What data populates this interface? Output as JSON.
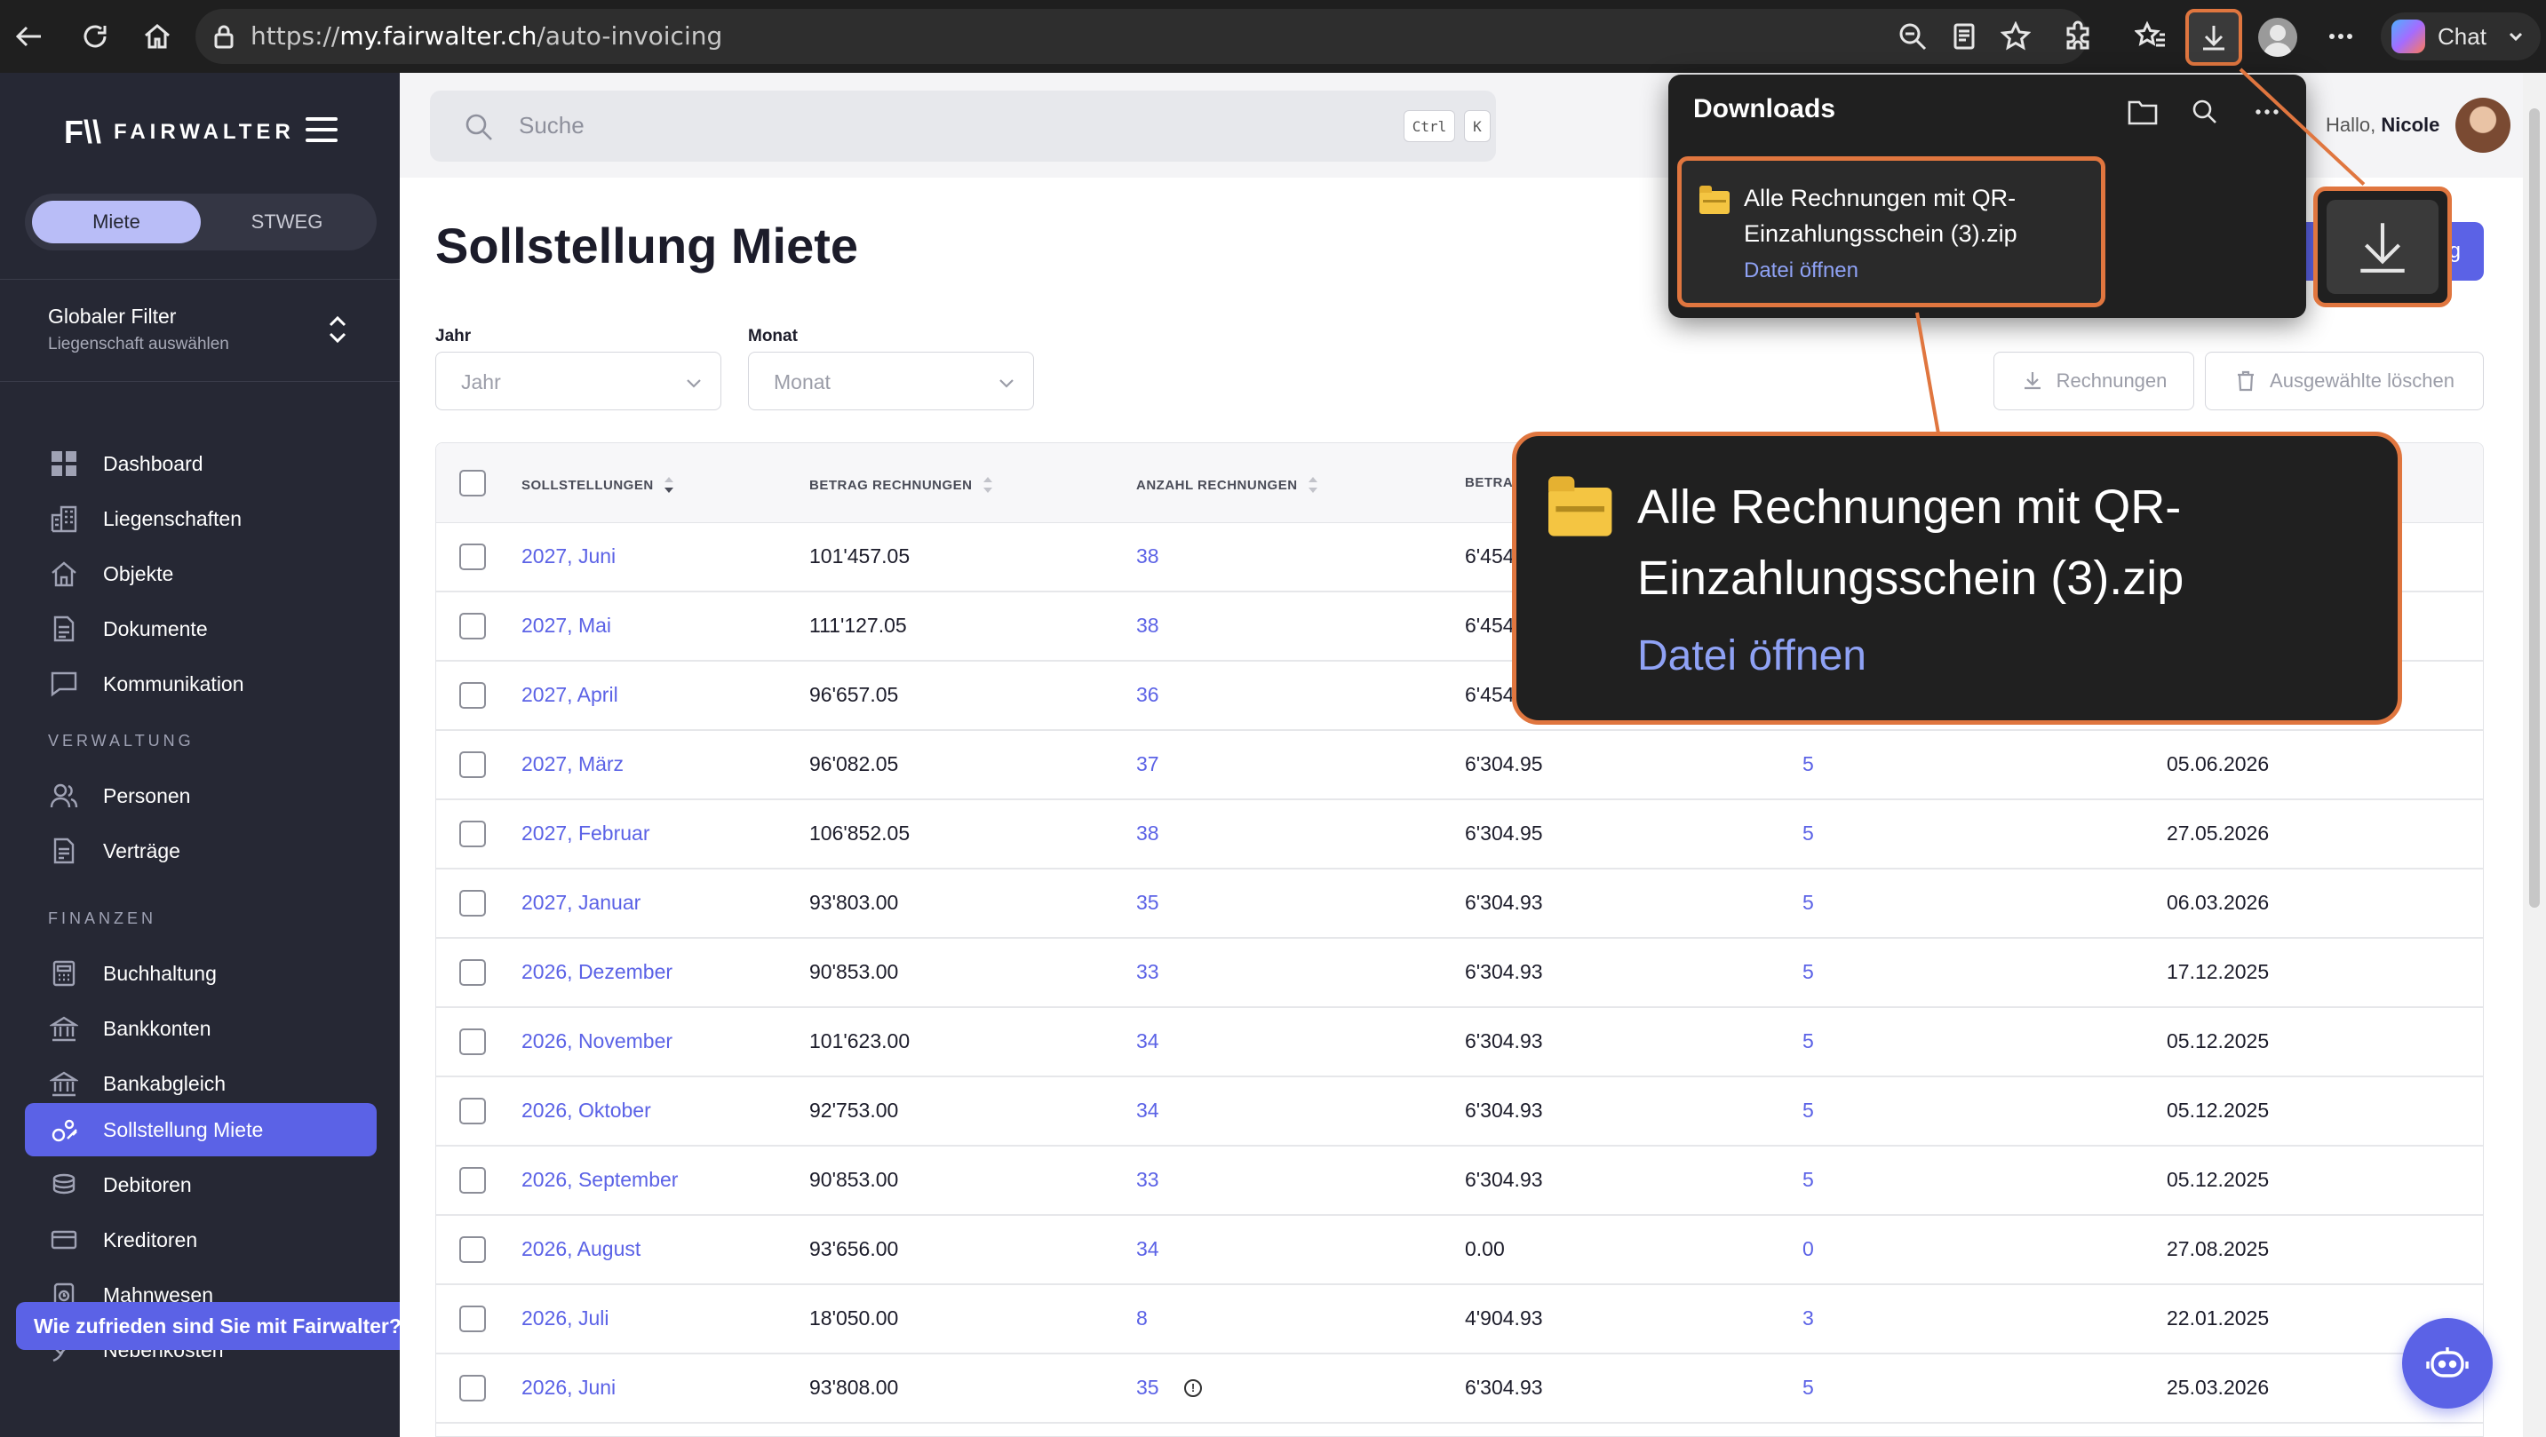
{
  "browser": {
    "url_prefix": "https://",
    "url_host": "my.fairwalter.ch",
    "url_path": "/auto-invoicing",
    "chat_label": "Chat"
  },
  "sidebar": {
    "brand": "FAIRWALTER",
    "brand_mark": "F\\\\",
    "toggle": {
      "active": "Miete",
      "inactive": "STWEG"
    },
    "global_filter": {
      "title": "Globaler Filter",
      "subtitle": "Liegenschaft auswählen"
    },
    "items": [
      {
        "label": "Dashboard",
        "icon": "grid-icon"
      },
      {
        "label": "Liegenschaften",
        "icon": "buildings-icon"
      },
      {
        "label": "Objekte",
        "icon": "house-icon"
      },
      {
        "label": "Dokumente",
        "icon": "document-icon"
      },
      {
        "label": "Kommunikation",
        "icon": "chat-icon"
      }
    ],
    "section_verwaltung": "VERWALTUNG",
    "verwaltung_items": [
      {
        "label": "Personen",
        "icon": "people-icon"
      },
      {
        "label": "Verträge",
        "icon": "contract-icon"
      }
    ],
    "section_finanzen": "FINANZEN",
    "finanzen_items": [
      {
        "label": "Buchhaltung",
        "icon": "calculator-icon"
      },
      {
        "label": "Bankkonten",
        "icon": "bank-icon"
      },
      {
        "label": "Bankabgleich",
        "icon": "bank-icon"
      },
      {
        "label": "Sollstellung Miete",
        "icon": "invoice-icon",
        "active": true
      },
      {
        "label": "Debitoren",
        "icon": "coins-icon"
      },
      {
        "label": "Kreditoren",
        "icon": "card-icon"
      },
      {
        "label": "Mahnwesen",
        "icon": "reminder-icon"
      },
      {
        "label": "Nebenkosten",
        "icon": "utility-icon"
      }
    ],
    "feedback": "Wie zufrieden sind Sie mit Fairwalter?"
  },
  "topbar": {
    "search_placeholder": "Suche",
    "kbd_1": "Ctrl",
    "kbd_2": "K",
    "greeting": "Hallo,",
    "user_name": "Nicole"
  },
  "page": {
    "title": "Sollstellung Miete",
    "primary_button_suffix": "g",
    "filters": {
      "year_label": "Jahr",
      "year_value": "Jahr",
      "month_label": "Monat",
      "month_value": "Monat"
    },
    "actions": {
      "invoices": "Rechnungen",
      "delete_selected": "Ausgewählte löschen"
    }
  },
  "table": {
    "headers": [
      "SOLLSTELLUNGEN",
      "BETRAG RECHNUNGEN",
      "ANZAHL RECHNUNGEN",
      "BETRA"
    ],
    "rows": [
      {
        "period": "2027, Juni",
        "amount": "101'457.05",
        "count": "38",
        "betrag2": "6'454",
        "count2": "",
        "date": ""
      },
      {
        "period": "2027, Mai",
        "amount": "111'127.05",
        "count": "38",
        "betrag2": "6'454",
        "count2": "",
        "date": ""
      },
      {
        "period": "2027, April",
        "amount": "96'657.05",
        "count": "36",
        "betrag2": "6'454",
        "count2": "",
        "date": ""
      },
      {
        "period": "2027, März",
        "amount": "96'082.05",
        "count": "37",
        "betrag2": "6'304.95",
        "count2": "5",
        "date": "05.06.2026"
      },
      {
        "period": "2027, Februar",
        "amount": "106'852.05",
        "count": "38",
        "betrag2": "6'304.95",
        "count2": "5",
        "date": "27.05.2026"
      },
      {
        "period": "2027, Januar",
        "amount": "93'803.00",
        "count": "35",
        "betrag2": "6'304.93",
        "count2": "5",
        "date": "06.03.2026"
      },
      {
        "period": "2026, Dezember",
        "amount": "90'853.00",
        "count": "33",
        "betrag2": "6'304.93",
        "count2": "5",
        "date": "17.12.2025"
      },
      {
        "period": "2026, November",
        "amount": "101'623.00",
        "count": "34",
        "betrag2": "6'304.93",
        "count2": "5",
        "date": "05.12.2025"
      },
      {
        "period": "2026, Oktober",
        "amount": "92'753.00",
        "count": "34",
        "betrag2": "6'304.93",
        "count2": "5",
        "date": "05.12.2025"
      },
      {
        "period": "2026, September",
        "amount": "90'853.00",
        "count": "33",
        "betrag2": "6'304.93",
        "count2": "5",
        "date": "05.12.2025"
      },
      {
        "period": "2026, August",
        "amount": "93'656.00",
        "count": "34",
        "betrag2": "0.00",
        "count2": "0",
        "date": "27.08.2025"
      },
      {
        "period": "2026, Juli",
        "amount": "18'050.00",
        "count": "8",
        "betrag2": "4'904.93",
        "count2": "3",
        "date": "22.01.2025"
      },
      {
        "period": "2026, Juni",
        "amount": "93'808.00",
        "count": "35",
        "betrag2": "6'304.93",
        "count2": "5",
        "date": "25.03.2026"
      }
    ]
  },
  "downloads": {
    "title": "Downloads",
    "file_name": "Alle Rechnungen mit QR-Einzahlungsschein (3).zip",
    "open_label": "Datei öffnen"
  },
  "colors": {
    "accent": "#5b62e6",
    "highlight": "#e0763f",
    "sidebar": "#262834"
  }
}
